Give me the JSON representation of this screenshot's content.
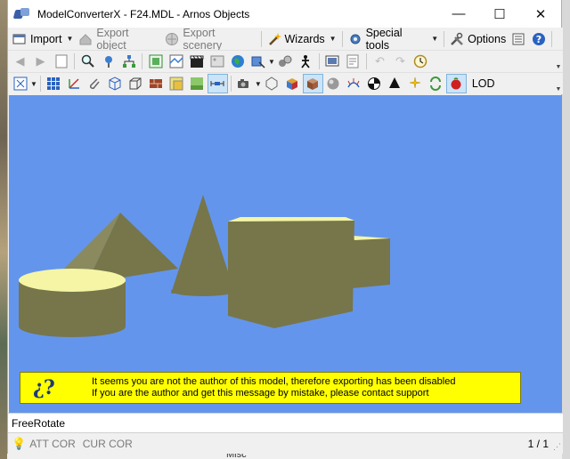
{
  "window": {
    "title": "ModelConverterX - F24.MDL - Arnos Objects",
    "minimize_glyph": "—",
    "maximize_glyph": "☐",
    "close_glyph": "✕"
  },
  "menu_toolbar": {
    "import_label": "Import",
    "export_object_label": "Export object",
    "export_scenery_label": "Export scenery",
    "wizards_label": "Wizards",
    "special_tools_label": "Special tools",
    "options_label": "Options"
  },
  "render_toolbar": {
    "lod_label": "LOD"
  },
  "viewport": {
    "background_color": "#6495ed",
    "shape_color": "#76764a",
    "highlight_color": "#f5f5a5"
  },
  "warning": {
    "icon_text": "¿?",
    "line1": "It seems you are not the author of this model, therefore exporting has been disabled",
    "line2": "If you are the author and get this message by mistake, please contact support",
    "background_color": "#ffff00"
  },
  "status": {
    "mode": "FreeRotate",
    "att_cor": "ATT COR",
    "cur_cor": "CUR COR",
    "page": "1 / 1"
  },
  "desktop": {
    "bottom_label": "Misc"
  }
}
